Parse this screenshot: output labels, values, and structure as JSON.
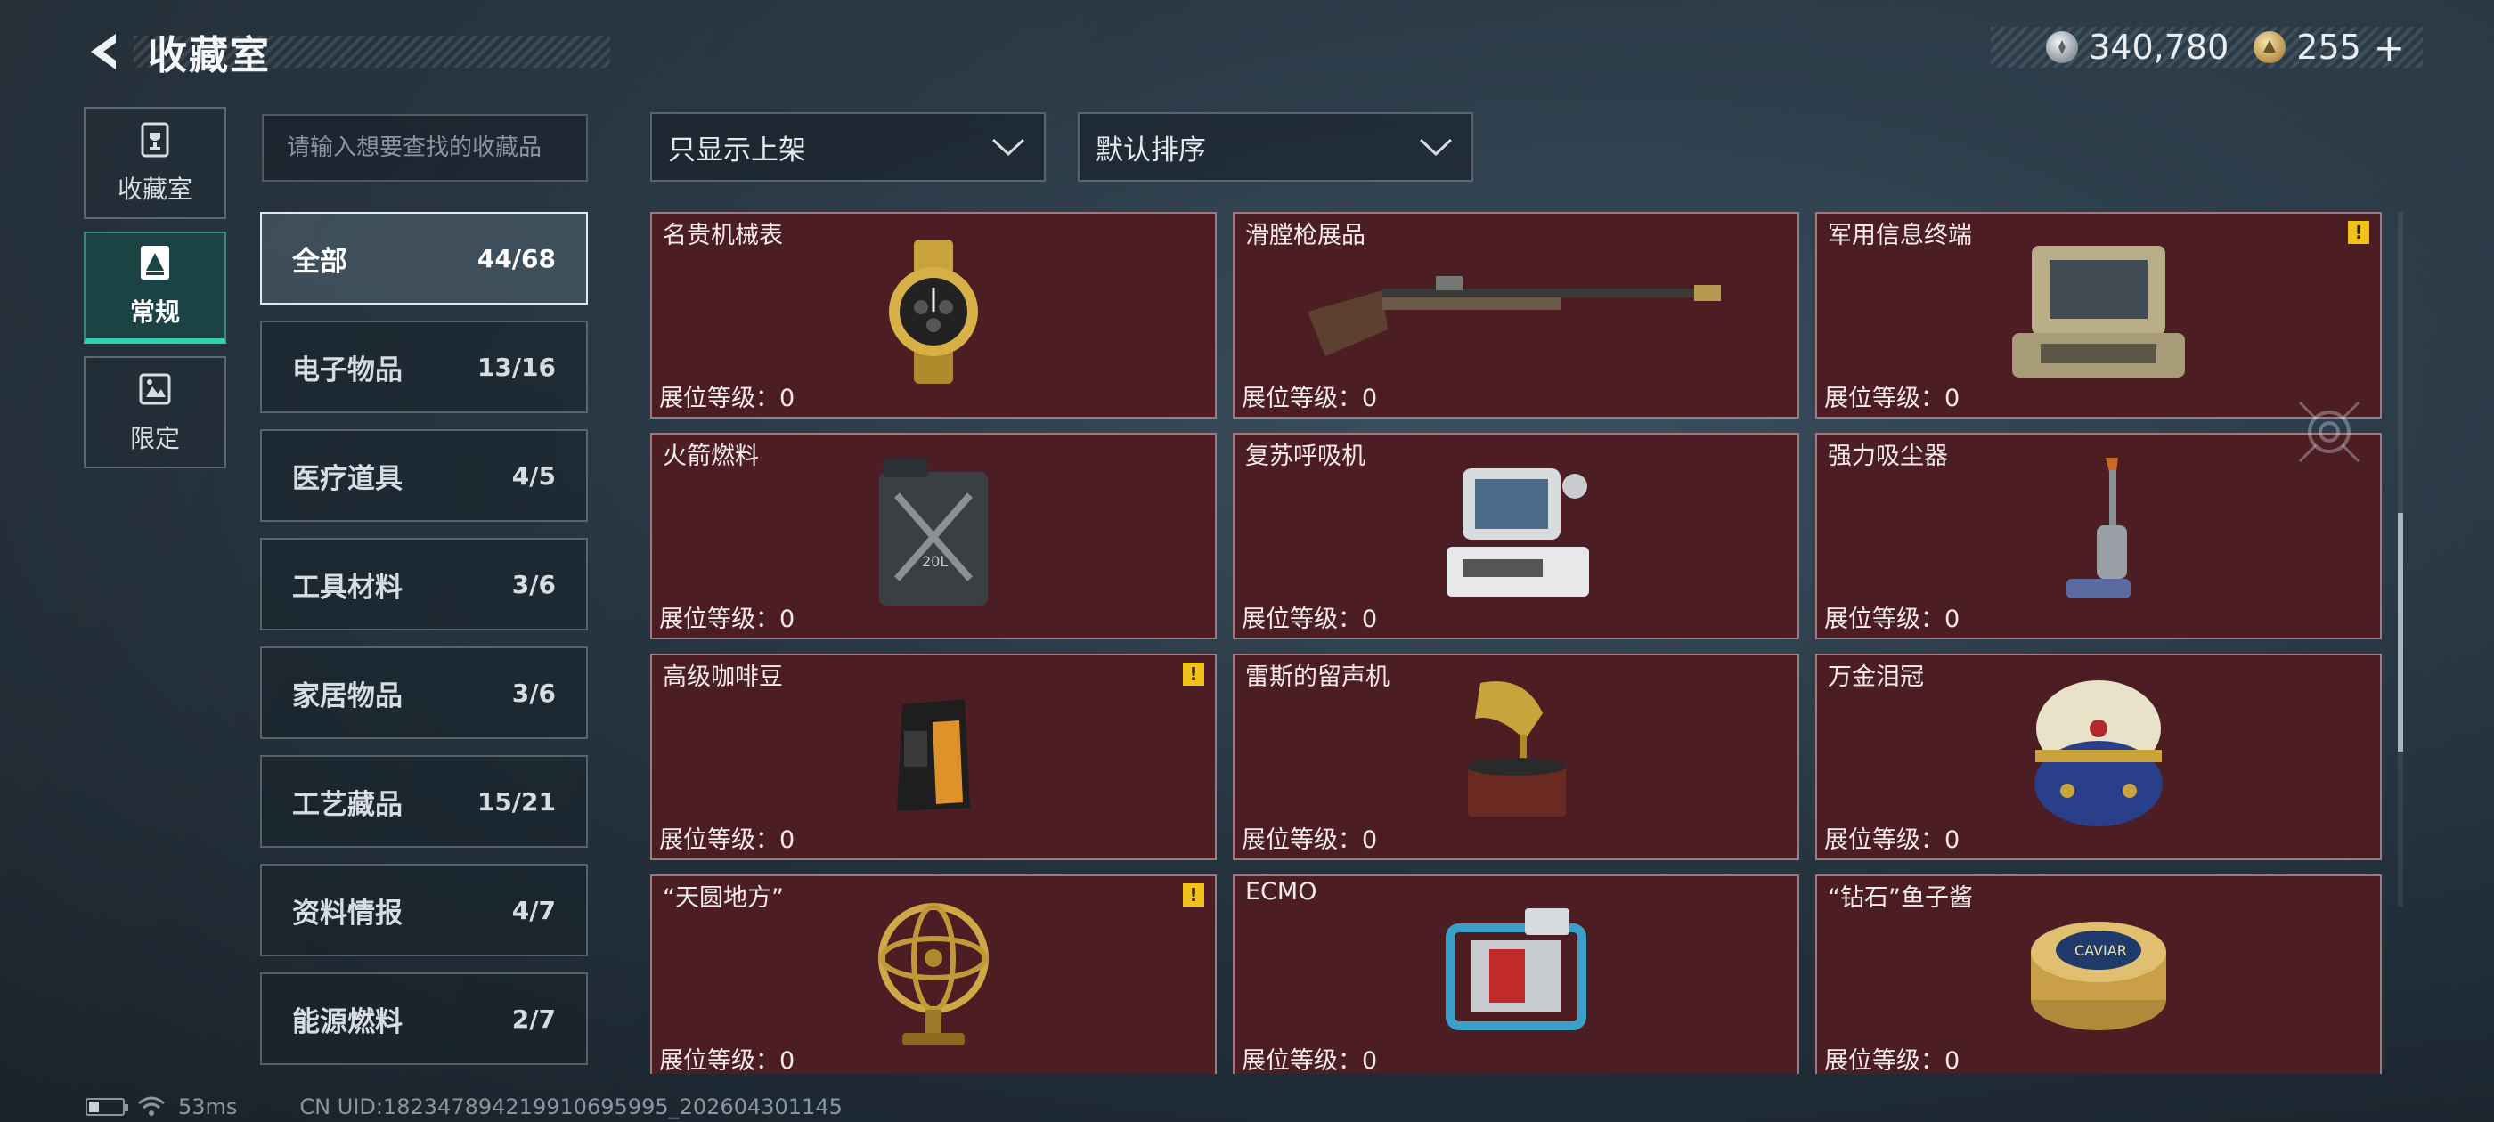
{
  "header": {
    "title": "收藏室",
    "back_icon": "back-arrow-icon"
  },
  "currency": {
    "silver": {
      "icon": "silver-coin-icon",
      "value": "340,780"
    },
    "gold": {
      "icon": "gold-coin-icon",
      "value": "255"
    },
    "plus": "+"
  },
  "leftnav": [
    {
      "label": "收藏室",
      "icon": "trophy-icon",
      "active": false
    },
    {
      "label": "常规",
      "icon": "collection-icon",
      "active": true
    },
    {
      "label": "限定",
      "icon": "limited-icon",
      "active": false
    }
  ],
  "search": {
    "placeholder": "请输入想要查找的收藏品",
    "value": ""
  },
  "categories": [
    {
      "name": "全部",
      "count": "44/68",
      "active": true
    },
    {
      "name": "电子物品",
      "count": "13/16"
    },
    {
      "name": "医疗道具",
      "count": "4/5"
    },
    {
      "name": "工具材料",
      "count": "3/6"
    },
    {
      "name": "家居物品",
      "count": "3/6"
    },
    {
      "name": "工艺藏品",
      "count": "15/21"
    },
    {
      "name": "资料情报",
      "count": "4/7"
    },
    {
      "name": "能源燃料",
      "count": "2/7"
    }
  ],
  "filters": {
    "show_filter": {
      "selected": "只显示上架"
    },
    "sort": {
      "selected": "默认排序"
    }
  },
  "items": [
    {
      "name": "名贵机械表",
      "level_label": "展位等级：",
      "level": "0",
      "alert": false,
      "art": "watch"
    },
    {
      "name": "滑膛枪展品",
      "level_label": "展位等级：",
      "level": "0",
      "alert": false,
      "art": "musket"
    },
    {
      "name": "军用信息终端",
      "level_label": "展位等级：",
      "level": "0",
      "alert": true,
      "art": "terminal"
    },
    {
      "name": "火箭燃料",
      "level_label": "展位等级：",
      "level": "0",
      "alert": false,
      "art": "jerrycan"
    },
    {
      "name": "复苏呼吸机",
      "level_label": "展位等级：",
      "level": "0",
      "alert": false,
      "art": "ventilator"
    },
    {
      "name": "强力吸尘器",
      "level_label": "展位等级：",
      "level": "0",
      "alert": false,
      "art": "vacuum"
    },
    {
      "name": "高级咖啡豆",
      "level_label": "展位等级：",
      "level": "0",
      "alert": true,
      "art": "coffee"
    },
    {
      "name": "雷斯的留声机",
      "level_label": "展位等级：",
      "level": "0",
      "alert": false,
      "art": "gramophone"
    },
    {
      "name": "万金泪冠",
      "level_label": "展位等级：",
      "level": "0",
      "alert": false,
      "art": "egg"
    },
    {
      "name": "“天圆地方”",
      "level_label": "展位等级：",
      "level": "0",
      "alert": true,
      "art": "armillary"
    },
    {
      "name": "ECMO",
      "level_label": "展位等级：",
      "level": "0",
      "alert": false,
      "art": "ecmo"
    },
    {
      "name": "“钻石”鱼子酱",
      "level_label": "展位等级：",
      "level": "0",
      "alert": false,
      "art": "caviar"
    }
  ],
  "caviar_label": "CAVIAR",
  "jerrycan_label": "20L",
  "alert_glyph": "!",
  "scroll": {
    "position": 0.66
  },
  "footer": {
    "battery_level": 0.3,
    "ping": "53ms",
    "uid": "CN UID:182347894219910695995_202604301145"
  },
  "colors": {
    "accent": "#2fd1b3",
    "card_bg": "#4d1d24",
    "alert": "#f2c21a"
  }
}
